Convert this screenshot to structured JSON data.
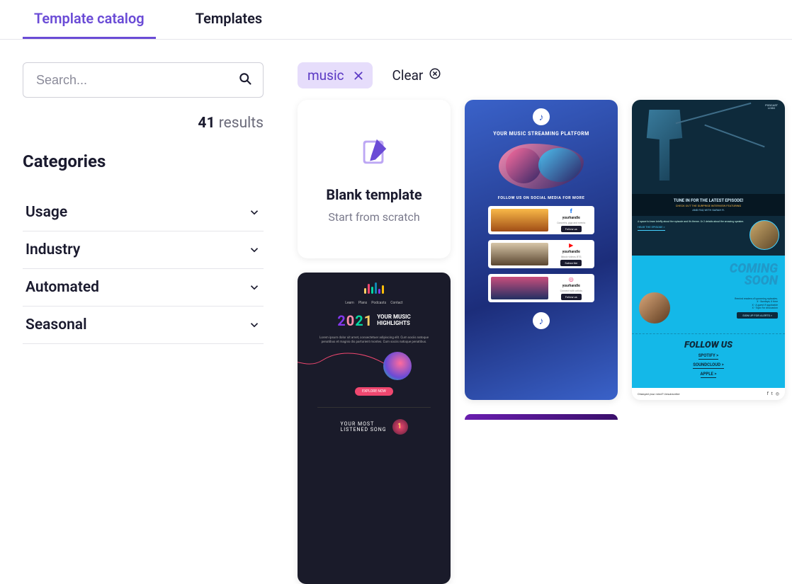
{
  "tabs": {
    "catalog": "Template catalog",
    "templates": "Templates"
  },
  "search": {
    "placeholder": "Search..."
  },
  "results": {
    "count": "41",
    "label": " results"
  },
  "sidebar": {
    "categories_title": "Categories",
    "filters": [
      "Usage",
      "Industry",
      "Automated",
      "Seasonal"
    ]
  },
  "chips": {
    "music": "music",
    "clear": "Clear"
  },
  "blank": {
    "title": "Blank template",
    "subtitle": "Start from scratch"
  },
  "thumbA": {
    "nav": [
      "Learn",
      "Plans",
      "Podcasts",
      "Contact"
    ],
    "year": "2021",
    "headline": "YOUR MUSIC\nHIGHLIGHTS",
    "lorem": "Lorem ipsum dolor sit amet, consectetuer adipiscing elit. Cum sociis natoque penatibus et magnis dis parturient montes. Cum sociis natoque penatibus.",
    "cta": "EXPLORE NOW",
    "most": "YOUR MOST\nLISTENED SONG",
    "badge": "1"
  },
  "thumbB": {
    "title": "YOUR MUSIC STREAMING PLATFORM",
    "subtitle": "FOLLOW US ON SOCIAL MEDIA FOR MORE",
    "cards": [
      {
        "icon": "f",
        "handle": "yourhandle",
        "mini": "Concerts, gigs and events",
        "btn": "Follow us"
      },
      {
        "icon": "▶",
        "handle": "yourhandle",
        "mini": "Music videos, BTS",
        "btn": "Subscribe"
      },
      {
        "icon": "◎",
        "handle": "yourhandle",
        "mini": "Connect with artists",
        "btn": "Follow us"
      }
    ],
    "note_glyph": "♪"
  },
  "thumbC": {
    "logo": "PODCAST\nLOGO",
    "tune": "TUNE IN FOR THE LATEST EPISODE!",
    "checkout": "CHECK OUT THE SURPRISE INTERVIEW FEATURING",
    "featuring_sub": "AND FAQ WITH SARAH R.",
    "feat_text": "A space to learn briefly about the episode and it's theme. Or 2 details about the amazing speaker.",
    "readmore": "HEAR THE EPISODE >",
    "coming": "COMING\nSOON",
    "meta": "Remind readers of upcoming episodes.\nX - Sundays, X time\nX - A guest if applicable\nX - Topic for discussion",
    "signup": "SIGN UP FOR ALERTS >",
    "follow": "FOLLOW US",
    "links": [
      "SPOTIFY >",
      "SOUNDCLOUD >",
      "APPLE >"
    ],
    "footer": "Changed your mind? Unsubscribe"
  }
}
